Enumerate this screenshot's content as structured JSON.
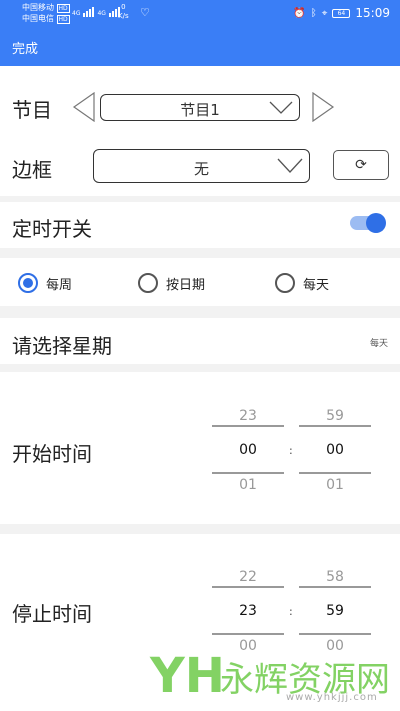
{
  "status_bar": {
    "carrier1": "中国移动",
    "carrier2": "中国电信",
    "net1": "4G",
    "net2": "4G",
    "speed_value": "0",
    "speed_unit": "K/s",
    "hd1": "HD",
    "hd2": "HD",
    "battery": "64",
    "time": "15:09"
  },
  "appbar": {
    "done_label": "完成"
  },
  "program": {
    "label": "节目",
    "value": "节目1"
  },
  "border": {
    "label": "边框",
    "value": "无"
  },
  "timer_switch": {
    "label": "定时开关",
    "on": true
  },
  "repeat": {
    "options": [
      "每周",
      "按日期",
      "每天"
    ],
    "selected": "每周"
  },
  "week": {
    "label": "请选择星期",
    "value": "每天"
  },
  "start_time": {
    "label": "开始时间",
    "hour": {
      "prev": "23",
      "current": "00",
      "next": "01"
    },
    "minute": {
      "prev": "59",
      "current": "00",
      "next": "01"
    },
    "separator": ":"
  },
  "stop_time": {
    "label": "停止时间",
    "hour": {
      "prev": "22",
      "current": "23",
      "next": "00"
    },
    "minute": {
      "prev": "58",
      "current": "59",
      "next": "00"
    },
    "separator": ":"
  },
  "watermark": {
    "brand": "永辉资源网",
    "logo": "YH",
    "url": "www.yhkjjj.com"
  },
  "colors": {
    "primary": "#3a7ef6",
    "accent": "#2f6fe6",
    "watermark": "#6ecb4a"
  }
}
